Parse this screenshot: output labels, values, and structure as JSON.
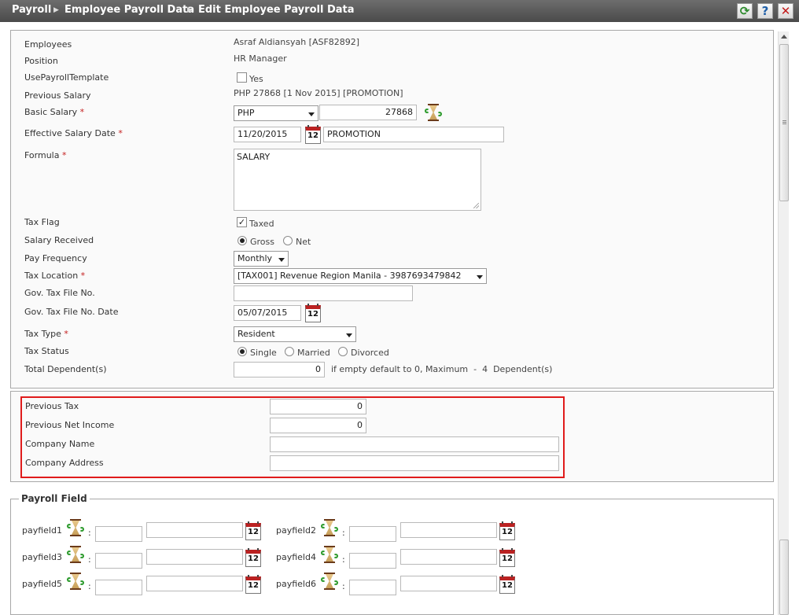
{
  "header": {
    "breadcrumb": [
      "Payroll",
      "Employee Payroll Data",
      "Edit Employee Payroll Data"
    ],
    "buttons": {
      "refresh": "refresh-icon",
      "help": "?",
      "close": "✕"
    }
  },
  "form": {
    "employees": {
      "label": "Employees",
      "value": "Asraf Aldiansyah [ASF82892]"
    },
    "position": {
      "label": "Position",
      "value": "HR Manager"
    },
    "use_template": {
      "label": "UsePayrollTemplate",
      "option": "Yes",
      "checked": false
    },
    "previous_salary": {
      "label": "Previous Salary",
      "value": "PHP 27868 [1 Nov 2015] [PROMOTION]"
    },
    "basic_salary": {
      "label": "Basic Salary",
      "currency": "PHP",
      "amount": "27868"
    },
    "effective_date": {
      "label": "Effective Salary Date",
      "date": "11/20/2015",
      "note": "PROMOTION"
    },
    "formula": {
      "label": "Formula",
      "value": "SALARY"
    },
    "tax_flag": {
      "label": "Tax Flag",
      "option": "Taxed",
      "checked": true
    },
    "salary_received": {
      "label": "Salary Received",
      "options": [
        "Gross",
        "Net"
      ],
      "selected": "Gross"
    },
    "pay_frequency": {
      "label": "Pay Frequency",
      "value": "Monthly"
    },
    "tax_location": {
      "label": "Tax Location",
      "value": "[TAX001] Revenue Region Manila - 3987693479842"
    },
    "gov_tax_file_no": {
      "label": "Gov. Tax File No.",
      "value": ""
    },
    "gov_tax_file_date": {
      "label": "Gov. Tax File No. Date",
      "date": "05/07/2015"
    },
    "tax_type": {
      "label": "Tax Type",
      "value": "Resident"
    },
    "tax_status": {
      "label": "Tax Status",
      "options": [
        "Single",
        "Married",
        "Divorced"
      ],
      "selected": "Single"
    },
    "total_dependents": {
      "label": "Total Dependent(s)",
      "value": "0",
      "hint": "if empty default to 0, Maximum  -  4  Dependent(s)"
    },
    "required_mark": "*",
    "calendar_day": "12"
  },
  "previous_employment": {
    "previous_tax": {
      "label": "Previous Tax",
      "value": "0"
    },
    "previous_net_income": {
      "label": "Previous Net Income",
      "value": "0"
    },
    "company_name": {
      "label": "Company Name",
      "value": ""
    },
    "company_address": {
      "label": "Company Address",
      "value": ""
    }
  },
  "payroll_field": {
    "legend": "Payroll Field",
    "colon": ":",
    "fields": [
      {
        "label": "payfield1",
        "code": "",
        "value": ""
      },
      {
        "label": "payfield2",
        "code": "",
        "value": ""
      },
      {
        "label": "payfield3",
        "code": "",
        "value": ""
      },
      {
        "label": "payfield4",
        "code": "",
        "value": ""
      },
      {
        "label": "payfield5",
        "code": "",
        "value": ""
      },
      {
        "label": "payfield6",
        "code": "",
        "value": ""
      }
    ]
  }
}
